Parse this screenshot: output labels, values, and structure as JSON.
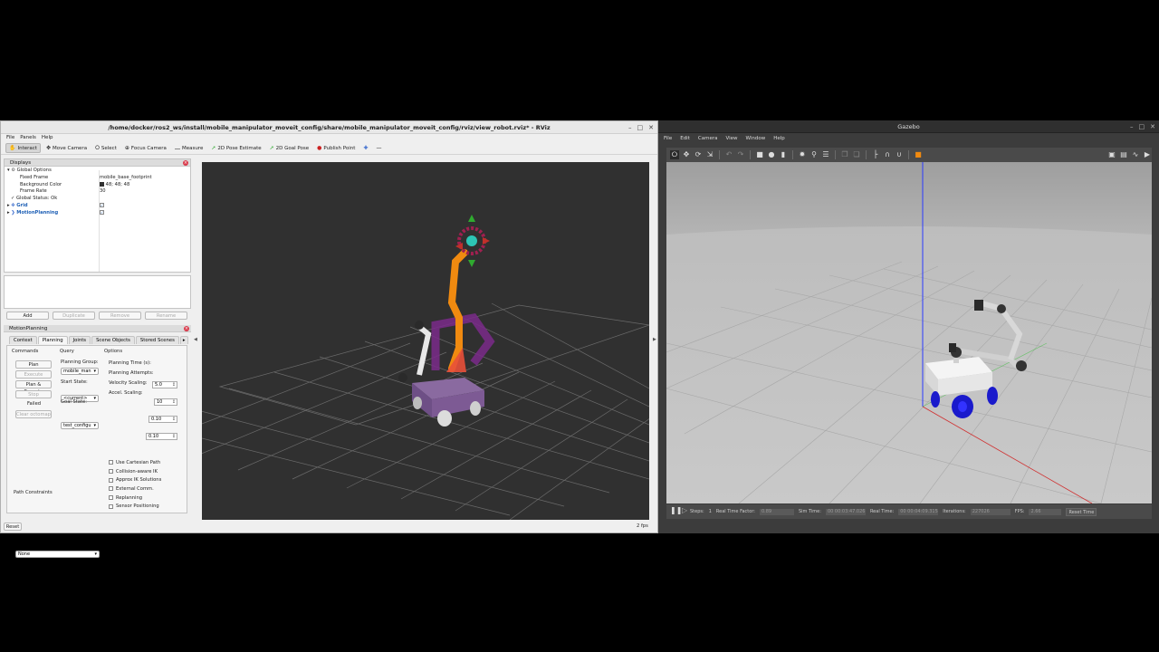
{
  "rviz": {
    "title": "/home/docker/ros2_ws/install/mobile_manipulator_moveit_config/share/mobile_manipulator_moveit_config/rviz/view_robot.rviz* - RViz",
    "menu": [
      "File",
      "Panels",
      "Help"
    ],
    "tools": [
      {
        "label": "Interact",
        "icon": "hand-icon",
        "active": true
      },
      {
        "label": "Move Camera",
        "icon": "camera-icon",
        "active": false
      },
      {
        "label": "Select",
        "icon": "cursor-icon",
        "active": false
      },
      {
        "label": "Focus Camera",
        "icon": "crosshair-icon",
        "active": false
      },
      {
        "label": "Measure",
        "icon": "ruler-icon",
        "active": false
      },
      {
        "label": "2D Pose Estimate",
        "icon": "green-arrow-icon",
        "active": false
      },
      {
        "label": "2D Goal Pose",
        "icon": "green-arrow-icon",
        "active": false
      },
      {
        "label": "Publish Point",
        "icon": "pin-icon",
        "active": false
      }
    ],
    "displays": {
      "title": "Displays",
      "global_options": "Global Options",
      "fixed_frame_label": "Fixed Frame",
      "fixed_frame_value": "mobile_base_footprint",
      "background_color_label": "Background Color",
      "background_color_value": "48; 48; 48",
      "frame_rate_label": "Frame Rate",
      "frame_rate_value": "30",
      "global_status": "Global Status: Ok",
      "grid": "Grid",
      "motion_planning": "MotionPlanning",
      "buttons": [
        "Add",
        "Duplicate",
        "Remove",
        "Rename"
      ]
    },
    "motion_panel": {
      "title": "MotionPlanning",
      "tabs": [
        "Context",
        "Planning",
        "Joints",
        "Scene Objects",
        "Stored Scenes"
      ],
      "commands_header": "Commands",
      "query_header": "Query",
      "options_header": "Options",
      "plan": "Plan",
      "execute": "Execute",
      "plan_execute": "Plan & Execute",
      "stop": "Stop",
      "status": "Failed",
      "clear_octomap": "Clear octomap",
      "planning_group_label": "Planning Group:",
      "planning_group_value": "mobile_man",
      "start_state_label": "Start State:",
      "start_state_value": "<current>",
      "goal_state_label": "Goal State:",
      "goal_state_value": "test_configu",
      "planning_time_label": "Planning Time (s):",
      "planning_time_value": "5.0",
      "planning_attempts_label": "Planning Attempts:",
      "planning_attempts_value": "10",
      "velocity_scaling_label": "Velocity Scaling:",
      "velocity_scaling_value": "0.10",
      "accel_scaling_label": "Accel. Scaling:",
      "accel_scaling_value": "0.10",
      "checkboxes": [
        "Use Cartesian Path",
        "Collision-aware IK",
        "Approx IK Solutions",
        "External Comm.",
        "Replanning",
        "Sensor Positioning"
      ],
      "path_constraints_label": "Path Constraints",
      "path_constraints_value": "None"
    },
    "reset": "Reset",
    "fps": "2 fps"
  },
  "gazebo": {
    "title": "Gazebo",
    "menu": [
      "File",
      "Edit",
      "Camera",
      "View",
      "Window",
      "Help"
    ],
    "status": {
      "steps_label": "Steps:",
      "steps_value": "1",
      "rtf_label": "Real Time Factor:",
      "rtf_value": "0.89",
      "sim_time_label": "Sim Time:",
      "sim_time_value": "00 00:03:47.026",
      "real_time_label": "Real Time:",
      "real_time_value": "00 00:04:09.315",
      "iterations_label": "Iterations:",
      "iterations_value": "227026",
      "fps_label": "FPS:",
      "fps_value": "2.66",
      "reset_time": "Reset Time"
    }
  },
  "colors": {
    "rviz_background": "#303030",
    "arm_orange": "#f08a10",
    "arm_purple": "#7a2a8a",
    "gazebo_sky": "#a8a8a8",
    "gazebo_ground": "#bdbdbd"
  }
}
